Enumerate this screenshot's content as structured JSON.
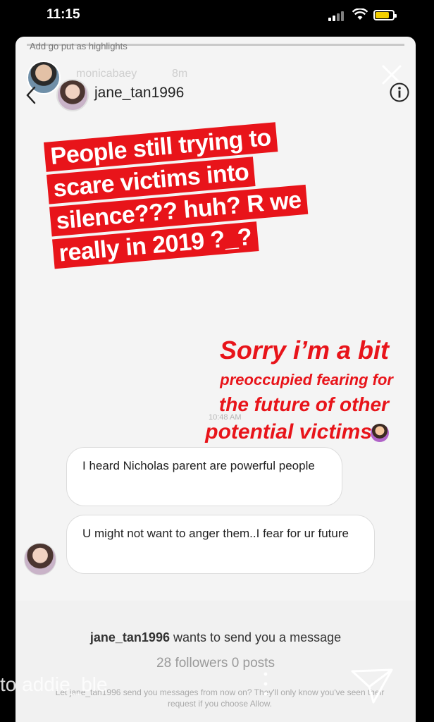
{
  "status_bar": {
    "time": "11:15"
  },
  "story": {
    "caption": "Add go put as highlights",
    "username": "monicabaey",
    "age": "8m"
  },
  "dm": {
    "username": "jane_tan1996"
  },
  "overlay": {
    "red_box_lines": [
      "People still trying to",
      "scare victims into",
      "silence??? huh? R we",
      "really in 2019 ?_?"
    ],
    "red_text_lines": [
      "Sorry i’m a bit",
      "preoccupied fearing for",
      "the future of other",
      "potential victims"
    ]
  },
  "messages": {
    "timestamp": "10:48 AM",
    "items": [
      {
        "text": "I heard Nicholas parent are powerful people"
      },
      {
        "text": "U might not want to anger them..I fear for ur future"
      }
    ]
  },
  "request": {
    "username": "jane_tan1996",
    "title_suffix": " wants to send you a message",
    "stats": "28 followers 0 posts",
    "note": "Let jane_tan1996 send you messages from now on? They'll only know you've seen their request if you choose Allow."
  },
  "watermark": "to addie_ble",
  "colors": {
    "accent_red": "#e8141a",
    "battery": "#f4d000"
  },
  "icons": [
    "back-icon",
    "info-icon",
    "close-icon",
    "send-icon",
    "signal-icon",
    "wifi-icon",
    "battery-icon"
  ]
}
